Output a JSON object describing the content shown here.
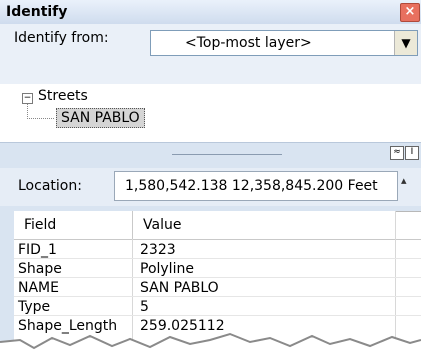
{
  "window": {
    "title": "Identify",
    "close_glyph": "×"
  },
  "identify_from": {
    "label": "Identify from:",
    "value": "<Top-most layer>",
    "arrow": "▼"
  },
  "tree": {
    "root_label": "Streets",
    "child_label": "SAN PABLO",
    "collapse_glyph": "−"
  },
  "splitter": {
    "btn1": "≈",
    "btn2": "I"
  },
  "location": {
    "label": "Location:",
    "value": "1,580,542.138  12,358,845.200 Feet",
    "dropdown_glyph": "▴"
  },
  "table": {
    "headers": [
      "Field",
      "Value"
    ],
    "rows": [
      {
        "field": "FID_1",
        "value": "2323"
      },
      {
        "field": "Shape",
        "value": "Polyline"
      },
      {
        "field": "NAME",
        "value": "SAN PABLO"
      },
      {
        "field": "Type",
        "value": "5"
      },
      {
        "field": "Shape_Length",
        "value": "259.025112"
      }
    ]
  }
}
